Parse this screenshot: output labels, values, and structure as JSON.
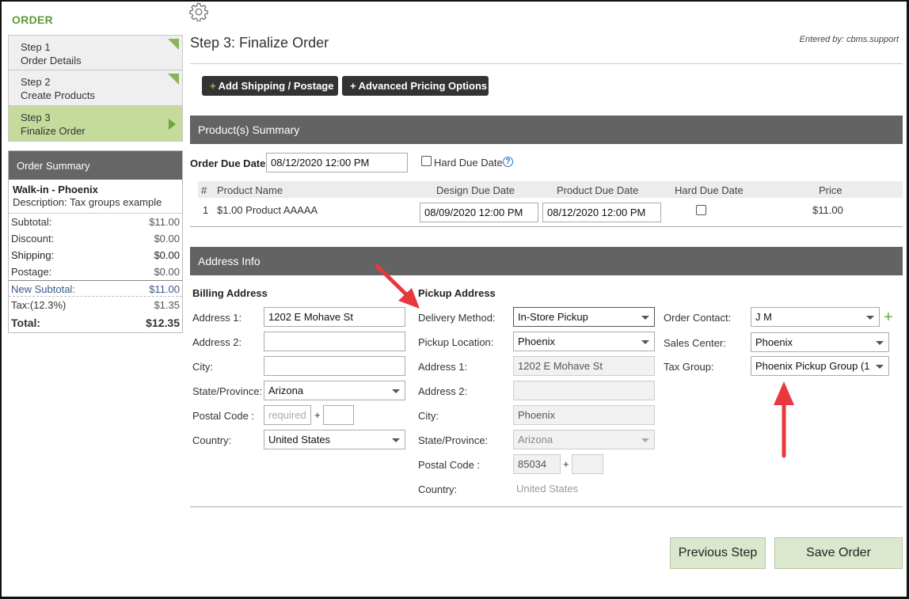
{
  "sidebar": {
    "title": "ORDER",
    "steps": [
      {
        "step": "Step 1",
        "label": "Order Details"
      },
      {
        "step": "Step 2",
        "label": "Create Products"
      },
      {
        "step": "Step 3",
        "label": "Finalize Order"
      }
    ],
    "active_step": 3
  },
  "order_summary": {
    "title": "Order Summary",
    "customer": "Walk-in - Phoenix",
    "description": "Description:  Tax groups example",
    "rows": {
      "subtotal": {
        "label": "Subtotal:",
        "value": "$11.00"
      },
      "discount": {
        "label": "Discount:",
        "value": "$0.00"
      },
      "shipping": {
        "label": "Shipping:",
        "value": "$0.00"
      },
      "postage": {
        "label": "Postage:",
        "value": "$0.00"
      },
      "new_subtotal": {
        "label": "New Subtotal:",
        "value": "$11.00"
      },
      "tax": {
        "label": "Tax:(12.3%)",
        "value": "$1.35"
      },
      "total": {
        "label": "Total:",
        "value": "$12.35"
      }
    }
  },
  "header": {
    "page_title": "Step 3: Finalize Order",
    "entered_by": "Entered by: cbms.support",
    "add_shipping": "Add Shipping / Postage",
    "advanced_pricing": "Advanced Pricing Options",
    "plus": "+"
  },
  "products": {
    "section_title": "Product(s) Summary",
    "order_due_label": "Order Due Date:",
    "order_due_value": "08/12/2020 12:00 PM",
    "hard_due_label": "Hard Due Date",
    "help_glyph": "?",
    "columns": [
      "#",
      "Product Name",
      "Design Due Date",
      "Product Due Date",
      "Hard Due Date",
      "Price"
    ],
    "rows": [
      {
        "num": "1",
        "name": "$1.00 Product AAAAA",
        "design_due": "08/09/2020 12:00 PM",
        "product_due": "08/12/2020 12:00 PM",
        "hard_due": false,
        "price": "$11.00"
      }
    ]
  },
  "address": {
    "section_title": "Address Info",
    "billing": {
      "title": "Billing Address",
      "address1_label": "Address 1:",
      "address1": "1202 E Mohave St",
      "address2_label": "Address 2:",
      "address2": "",
      "city_label": "City:",
      "city": "",
      "state_label": "State/Province:",
      "state": "Arizona",
      "postal_label": "Postal Code :",
      "postal_placeholder": "required",
      "postal_plus": "+",
      "country_label": "Country:",
      "country": "United States"
    },
    "pickup": {
      "title": "Pickup Address",
      "delivery_label": "Delivery Method:",
      "delivery": "In-Store Pickup",
      "location_label": "Pickup Location:",
      "location": "Phoenix",
      "address1_label": "Address 1:",
      "address1": "1202 E Mohave St",
      "address2_label": "Address 2:",
      "address2": "",
      "city_label": "City:",
      "city": "Phoenix",
      "state_label": "State/Province:",
      "state": "Arizona",
      "postal_label": "Postal Code :",
      "postal": "85034",
      "postal_plus": "+",
      "country_label": "Country:",
      "country": "United States"
    },
    "other": {
      "contact_label": "Order Contact:",
      "contact": "J M",
      "add_glyph": "+",
      "sales_center_label": "Sales Center:",
      "sales_center": "Phoenix",
      "tax_group_label": "Tax Group:",
      "tax_group": "Phoenix Pickup Group (1"
    }
  },
  "footer": {
    "previous": "Previous Step",
    "save": "Save Order"
  },
  "colors": {
    "accent_green": "#5f9a3a",
    "section_bar": "#636363",
    "annotation_arrow": "#e8383d"
  }
}
